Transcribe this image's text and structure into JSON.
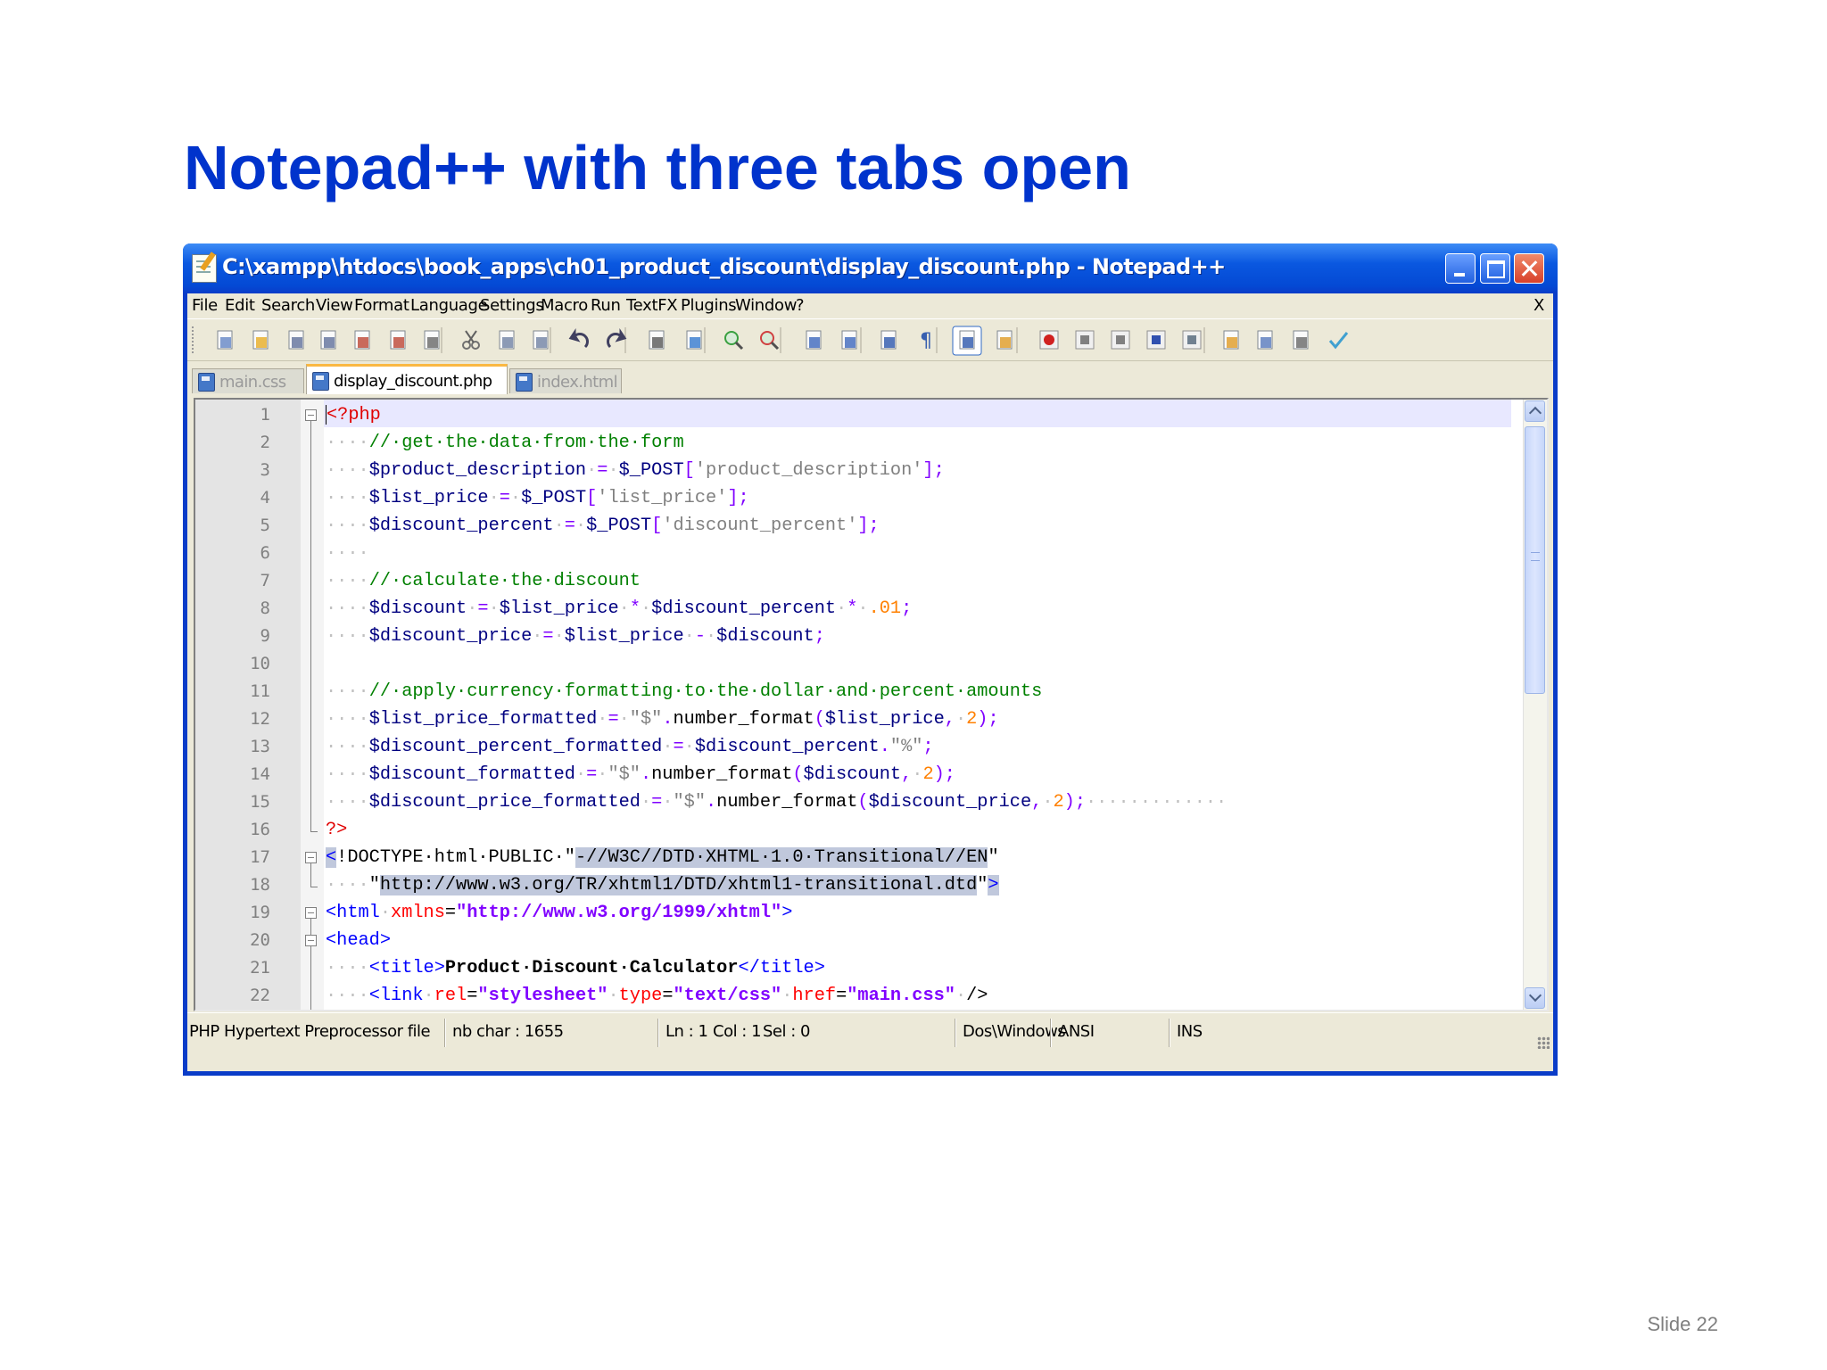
{
  "slide": {
    "title": "Notepad++ with three tabs open",
    "number": "Slide 22"
  },
  "window": {
    "title": "C:\\xampp\\htdocs\\book_apps\\ch01_product_discount\\display_discount.php - Notepad++"
  },
  "menu": {
    "items": [
      "File",
      "Edit",
      "Search",
      "View",
      "Format",
      "Language",
      "Settings",
      "Macro",
      "Run",
      "TextFX",
      "Plugins",
      "Window",
      "?"
    ],
    "close": "X"
  },
  "toolbar": {
    "icons": [
      "new-file-icon",
      "open-file-icon",
      "save-icon",
      "save-all-icon",
      "close-icon",
      "close-all-icon",
      "print-icon",
      "cut-icon",
      "copy-icon",
      "paste-icon",
      "undo-icon",
      "redo-icon",
      "find-icon",
      "replace-icon",
      "zoom-in-icon",
      "zoom-out-icon",
      "sync-vertical-icon",
      "sync-horizontal-icon",
      "word-wrap-icon",
      "show-all-chars-icon",
      "indent-guide-icon",
      "user-lang-icon",
      "record-macro-icon",
      "stop-macro-icon",
      "play-macro-icon",
      "run-macro-multiple-icon",
      "save-macro-icon",
      "folder-icon",
      "panel-icon",
      "file-explorer-icon",
      "spell-check-icon"
    ]
  },
  "tabs": [
    {
      "label": "main.css",
      "active": false
    },
    {
      "label": "display_discount.php",
      "active": true
    },
    {
      "label": "index.html",
      "active": false
    }
  ],
  "editor": {
    "line_numbers": [
      "1",
      "2",
      "3",
      "4",
      "5",
      "6",
      "7",
      "8",
      "9",
      "10",
      "11",
      "12",
      "13",
      "14",
      "15",
      "16",
      "17",
      "18",
      "19",
      "20",
      "21",
      "22"
    ],
    "lines": [
      [
        [
          "php",
          "<?php"
        ]
      ],
      [
        [
          "ws",
          "····"
        ],
        [
          "com",
          "//·get·the·data·from·the·form"
        ]
      ],
      [
        [
          "ws",
          "····"
        ],
        [
          "var",
          "$product_description"
        ],
        [
          "ws",
          "·"
        ],
        [
          "op",
          "="
        ],
        [
          "ws",
          "·"
        ],
        [
          "var",
          "$_POST"
        ],
        [
          "op",
          "["
        ],
        [
          "str",
          "'product_description'"
        ],
        [
          "op",
          "];"
        ]
      ],
      [
        [
          "ws",
          "····"
        ],
        [
          "var",
          "$list_price"
        ],
        [
          "ws",
          "·"
        ],
        [
          "op",
          "="
        ],
        [
          "ws",
          "·"
        ],
        [
          "var",
          "$_POST"
        ],
        [
          "op",
          "["
        ],
        [
          "str",
          "'list_price'"
        ],
        [
          "op",
          "];"
        ]
      ],
      [
        [
          "ws",
          "····"
        ],
        [
          "var",
          "$discount_percent"
        ],
        [
          "ws",
          "·"
        ],
        [
          "op",
          "="
        ],
        [
          "ws",
          "·"
        ],
        [
          "var",
          "$_POST"
        ],
        [
          "op",
          "["
        ],
        [
          "str",
          "'discount_percent'"
        ],
        [
          "op",
          "];"
        ]
      ],
      [
        [
          "ws",
          "····"
        ]
      ],
      [
        [
          "ws",
          "····"
        ],
        [
          "com",
          "//·calculate·the·discount"
        ]
      ],
      [
        [
          "ws",
          "····"
        ],
        [
          "var",
          "$discount"
        ],
        [
          "ws",
          "·"
        ],
        [
          "op",
          "="
        ],
        [
          "ws",
          "·"
        ],
        [
          "var",
          "$list_price"
        ],
        [
          "ws",
          "·"
        ],
        [
          "op",
          "*"
        ],
        [
          "ws",
          "·"
        ],
        [
          "var",
          "$discount_percent"
        ],
        [
          "ws",
          "·"
        ],
        [
          "op",
          "*"
        ],
        [
          "ws",
          "·"
        ],
        [
          "num",
          ".01"
        ],
        [
          "op",
          ";"
        ]
      ],
      [
        [
          "ws",
          "····"
        ],
        [
          "var",
          "$discount_price"
        ],
        [
          "ws",
          "·"
        ],
        [
          "op",
          "="
        ],
        [
          "ws",
          "·"
        ],
        [
          "var",
          "$list_price"
        ],
        [
          "ws",
          "·"
        ],
        [
          "op",
          "-"
        ],
        [
          "ws",
          "·"
        ],
        [
          "var",
          "$discount"
        ],
        [
          "op",
          ";"
        ]
      ],
      [],
      [
        [
          "ws",
          "····"
        ],
        [
          "com",
          "//·apply·currency·formatting·to·the·dollar·and·percent·amounts"
        ]
      ],
      [
        [
          "ws",
          "····"
        ],
        [
          "var",
          "$list_price_formatted"
        ],
        [
          "ws",
          "·"
        ],
        [
          "op",
          "="
        ],
        [
          "ws",
          "·"
        ],
        [
          "str",
          "\"$\""
        ],
        [
          "op",
          "."
        ],
        [
          "plain",
          "number_format"
        ],
        [
          "op",
          "("
        ],
        [
          "var",
          "$list_price"
        ],
        [
          "op",
          ","
        ],
        [
          "ws",
          "·"
        ],
        [
          "num",
          "2"
        ],
        [
          "op",
          ");"
        ]
      ],
      [
        [
          "ws",
          "····"
        ],
        [
          "var",
          "$discount_percent_formatted"
        ],
        [
          "ws",
          "·"
        ],
        [
          "op",
          "="
        ],
        [
          "ws",
          "·"
        ],
        [
          "var",
          "$discount_percent"
        ],
        [
          "op",
          "."
        ],
        [
          "str",
          "\"%\""
        ],
        [
          "op",
          ";"
        ]
      ],
      [
        [
          "ws",
          "····"
        ],
        [
          "var",
          "$discount_formatted"
        ],
        [
          "ws",
          "·"
        ],
        [
          "op",
          "="
        ],
        [
          "ws",
          "·"
        ],
        [
          "str",
          "\"$\""
        ],
        [
          "op",
          "."
        ],
        [
          "plain",
          "number_format"
        ],
        [
          "op",
          "("
        ],
        [
          "var",
          "$discount"
        ],
        [
          "op",
          ","
        ],
        [
          "ws",
          "·"
        ],
        [
          "num",
          "2"
        ],
        [
          "op",
          ");"
        ]
      ],
      [
        [
          "ws",
          "····"
        ],
        [
          "var",
          "$discount_price_formatted"
        ],
        [
          "ws",
          "·"
        ],
        [
          "op",
          "="
        ],
        [
          "ws",
          "·"
        ],
        [
          "str",
          "\"$\""
        ],
        [
          "op",
          "."
        ],
        [
          "plain",
          "number_format"
        ],
        [
          "op",
          "("
        ],
        [
          "var",
          "$discount_price"
        ],
        [
          "op",
          ","
        ],
        [
          "ws",
          "·"
        ],
        [
          "num",
          "2"
        ],
        [
          "op",
          ");"
        ],
        [
          "ws",
          "·············"
        ]
      ],
      [
        [
          "php",
          "?>"
        ]
      ],
      [
        [
          "tagsel",
          "<"
        ],
        [
          "plain",
          "!DOCTYPE·html·PUBLIC·"
        ],
        [
          "plain",
          "\""
        ],
        [
          "sel",
          "-//W3C//DTD·XHTML·1.0·Transitional//EN"
        ],
        [
          "plain",
          "\""
        ]
      ],
      [
        [
          "ws",
          "····"
        ],
        [
          "plain",
          "\""
        ],
        [
          "sel",
          "http://www.w3.org/TR/xhtml1/DTD/xhtml1-transitional.dtd"
        ],
        [
          "plain",
          "\""
        ],
        [
          "tagsel",
          ">"
        ]
      ],
      [
        [
          "tag",
          "<html"
        ],
        [
          "ws",
          "·"
        ],
        [
          "att",
          "xmlns"
        ],
        [
          "plain",
          "="
        ],
        [
          "val",
          "\"http://www.w3.org/1999/xhtml\""
        ],
        [
          "tag",
          ">"
        ]
      ],
      [
        [
          "tag",
          "<head>"
        ]
      ],
      [
        [
          "ws",
          "····"
        ],
        [
          "tag",
          "<title>"
        ],
        [
          "bold",
          "Product·Discount·Calculator"
        ],
        [
          "tag",
          "</title>"
        ]
      ],
      [
        [
          "ws",
          "····"
        ],
        [
          "tag",
          "<link"
        ],
        [
          "ws",
          "·"
        ],
        [
          "att",
          "rel"
        ],
        [
          "plain",
          "="
        ],
        [
          "val",
          "\"stylesheet\""
        ],
        [
          "ws",
          "·"
        ],
        [
          "att",
          "type"
        ],
        [
          "plain",
          "="
        ],
        [
          "val",
          "\"text/css\""
        ],
        [
          "ws",
          "·"
        ],
        [
          "att",
          "href"
        ],
        [
          "plain",
          "="
        ],
        [
          "val",
          "\"main.css\""
        ],
        [
          "ws",
          "·"
        ],
        [
          "plain",
          "/>"
        ]
      ]
    ]
  },
  "status": {
    "file_type": "PHP Hypertext Preprocessor file",
    "length": "nb char : 1655",
    "ln": "Ln : 1",
    "col": "Col : 1",
    "sel": "Sel : 0",
    "eol": "Dos\\Windows",
    "encoding": "ANSI",
    "mode": "INS"
  }
}
